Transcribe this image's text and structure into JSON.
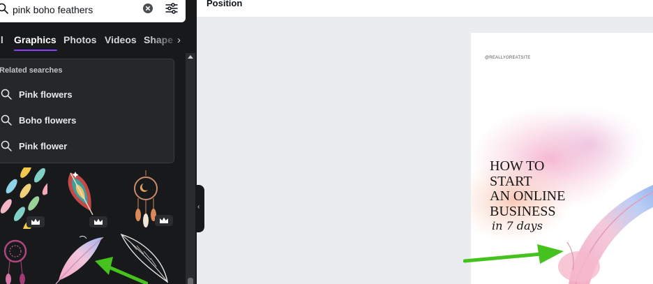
{
  "search": {
    "query": "pink boho feathers"
  },
  "tabs": {
    "all": "ll",
    "graphics": "Graphics",
    "photos": "Photos",
    "videos": "Videos",
    "shapes": "Shape"
  },
  "related": {
    "title": "Related searches",
    "items": [
      {
        "label": "Pink flowers"
      },
      {
        "label": "Boho flowers"
      },
      {
        "label": "Pink flower"
      }
    ]
  },
  "header": {
    "position_label": "Position"
  },
  "design": {
    "handle": "@REALLYGREATSITE",
    "headline": [
      "HOW TO",
      "START",
      "AN ONLINE",
      "BUSINESS"
    ],
    "subtitle": "in 7 days"
  },
  "colors": {
    "accent": "#8b3dff",
    "panel": "#18191b",
    "annotation_arrow": "#45c21e"
  }
}
